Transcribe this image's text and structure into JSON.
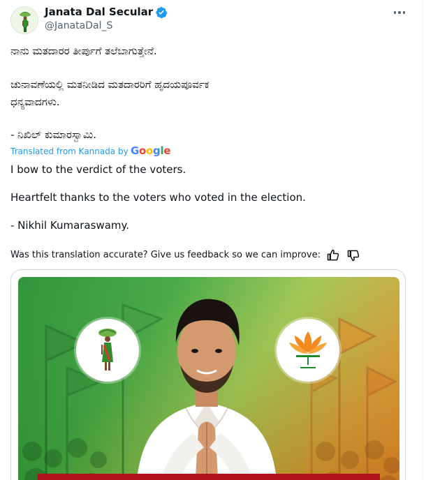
{
  "account": {
    "display_name": "Janata Dal Secular",
    "handle": "@JanataDal_S"
  },
  "tweet_kannada": {
    "line1": "ನಾನು ಮತದಾರರ ತೀರ್ಪುಗೆ ತಲೆಬಾಗುತ್ತೇನೆ.",
    "line2": "ಚುನಾವಣೆಯಲ್ಲಿ  ಮತನೀಡಿದ ಮತದಾರರಿಗೆ ಹೃದಯಪೂರ್ವಕ",
    "line3": "ಧನ್ಯವಾದಗಳು.",
    "line4": "- ನಿಖಿಲ್ ಕುಮಾರಸ್ವಾಮಿ."
  },
  "translation": {
    "label": "Translated from Kannada by",
    "provider": "Google",
    "provider_letters": [
      "G",
      "o",
      "o",
      "g",
      "l",
      "e"
    ],
    "provider_colors": [
      "#4285f4",
      "#ea4335",
      "#fbbc05",
      "#4285f4",
      "#34a853",
      "#ea4335"
    ],
    "line1": "I bow to the verdict of the voters.",
    "line2": "Heartfelt thanks to the voters who voted in the election.",
    "line3": "- Nikhil Kumaraswamy."
  },
  "feedback": {
    "prompt": "Was this translation accurate? Give us feedback so we can improve:",
    "icons": [
      "thumbs-up-icon",
      "thumbs-down-icon"
    ]
  },
  "colors": {
    "link": "#1d9bf0",
    "text": "#0f1419",
    "muted": "#536471",
    "verified": "#1d9bf0"
  }
}
